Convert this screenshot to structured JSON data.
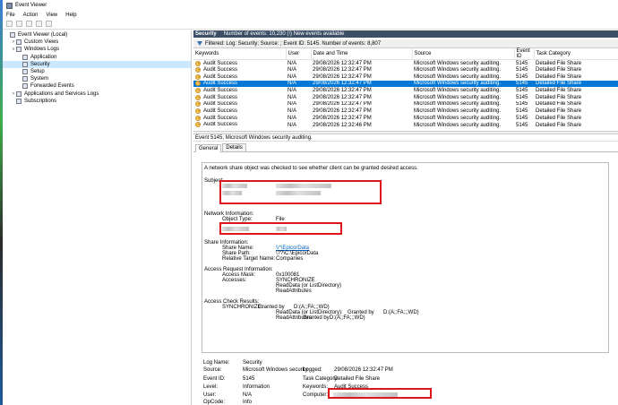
{
  "window": {
    "title": "Event Viewer"
  },
  "menu": [
    "File",
    "Action",
    "View",
    "Help"
  ],
  "tree": [
    {
      "label": "Event Viewer (Local)",
      "indent": 0,
      "toggle": "",
      "selected": false
    },
    {
      "label": "Custom Views",
      "indent": 1,
      "toggle": ">",
      "selected": false
    },
    {
      "label": "Windows Logs",
      "indent": 1,
      "toggle": "v",
      "selected": false
    },
    {
      "label": "Application",
      "indent": 2,
      "toggle": "",
      "selected": false
    },
    {
      "label": "Security",
      "indent": 2,
      "toggle": "",
      "selected": true
    },
    {
      "label": "Setup",
      "indent": 2,
      "toggle": "",
      "selected": false
    },
    {
      "label": "System",
      "indent": 2,
      "toggle": "",
      "selected": false
    },
    {
      "label": "Forwarded Events",
      "indent": 2,
      "toggle": "",
      "selected": false
    },
    {
      "label": "Applications and Services Logs",
      "indent": 1,
      "toggle": ">",
      "selected": false
    },
    {
      "label": "Subscriptions",
      "indent": 1,
      "toggle": "",
      "selected": false
    }
  ],
  "log_header": {
    "name": "Security",
    "info": "Number of events: 10,230 (!) New events available"
  },
  "filter_text": "Filtered: Log: Security; Source: ; Event ID: 5145. Number of events: 8,807",
  "columns": [
    "Keywords",
    "User",
    "Date and Time",
    "Source",
    "Event ID",
    "Task Category"
  ],
  "rows": [
    {
      "keywords": "Audit Success",
      "user": "N/A",
      "date": "29/08/2026 12:32:47 PM",
      "source": "Microsoft Windows security auditing.",
      "id": "5145",
      "category": "Detailed File Share",
      "selected": false
    },
    {
      "keywords": "Audit Success",
      "user": "N/A",
      "date": "29/08/2026 12:32:47 PM",
      "source": "Microsoft Windows security auditing.",
      "id": "5145",
      "category": "Detailed File Share",
      "selected": false
    },
    {
      "keywords": "Audit Success",
      "user": "N/A",
      "date": "29/08/2026 12:32:47 PM",
      "source": "Microsoft Windows security auditing.",
      "id": "5145",
      "category": "Detailed File Share",
      "selected": false
    },
    {
      "keywords": "Audit Success",
      "user": "N/A",
      "date": "29/08/2026 12:32:47 PM",
      "source": "Microsoft Windows security auditing.",
      "id": "5145",
      "category": "Detailed File Share",
      "selected": true
    },
    {
      "keywords": "Audit Success",
      "user": "N/A",
      "date": "29/08/2026 12:32:47 PM",
      "source": "Microsoft Windows security auditing.",
      "id": "5145",
      "category": "Detailed File Share",
      "selected": false
    },
    {
      "keywords": "Audit Success",
      "user": "N/A",
      "date": "29/08/2026 12:32:47 PM",
      "source": "Microsoft Windows security auditing.",
      "id": "5145",
      "category": "Detailed File Share",
      "selected": false
    },
    {
      "keywords": "Audit Success",
      "user": "N/A",
      "date": "29/08/2026 12:32:47 PM",
      "source": "Microsoft Windows security auditing.",
      "id": "5145",
      "category": "Detailed File Share",
      "selected": false
    },
    {
      "keywords": "Audit Success",
      "user": "N/A",
      "date": "29/08/2026 12:32:47 PM",
      "source": "Microsoft Windows security auditing.",
      "id": "5145",
      "category": "Detailed File Share",
      "selected": false
    },
    {
      "keywords": "Audit Success",
      "user": "N/A",
      "date": "29/08/2026 12:32:47 PM",
      "source": "Microsoft Windows security auditing.",
      "id": "5145",
      "category": "Detailed File Share",
      "selected": false
    },
    {
      "keywords": "Audit Success",
      "user": "N/A",
      "date": "29/08/2026 12:32:46 PM",
      "source": "Microsoft Windows security auditing.",
      "id": "5145",
      "category": "Detailed File Share",
      "selected": false
    }
  ],
  "detail": {
    "title": "Event 5145, Microsoft Windows security auditing.",
    "tabs": [
      "General",
      "Details"
    ],
    "intro": "A network share object was checked to see whether client can be granted desired access.",
    "subject_label": "Subject:",
    "network_label": "Network Information:",
    "object_type_label": "Object Type:",
    "object_type_value": "File",
    "share_label": "Share Information:",
    "share_name_label": "Share Name:",
    "share_name_value": "\\\\*\\EpicorData",
    "share_path_label": "Share Path:",
    "share_path_value": "\\??\\C:\\EpicorData",
    "rel_target_label": "Relative Target Name:",
    "rel_target_value": "Companies",
    "access_label": "Access Request Information:",
    "mask_label": "Access Mask:",
    "mask_value": "0x100081",
    "accesses_label": "Accesses:",
    "accesses": [
      "SYNCHRONIZE",
      "ReadData (or ListDirectory)",
      "ReadAttributes"
    ],
    "check_label": "Access Check Results:",
    "check_lines": [
      {
        "a": "SYNCHRONIZE:",
        "b": "Granted by",
        "c": "D:(A;;FA;;;WD)"
      },
      {
        "a": "ReadData (or ListDirectory):",
        "b": "Granted by",
        "c": "D:(A;;FA;;;WD)"
      },
      {
        "a": "ReadAttributes:",
        "b": "Granted by",
        "c": "D:(A;;FA;;;WD)"
      }
    ]
  },
  "props": {
    "log_name_label": "Log Name:",
    "log_name_value": "Security",
    "source_label": "Source:",
    "source_value": "Microsoft Windows security",
    "logged_label": "Logged:",
    "logged_value": "29/08/2026 12:32:47 PM",
    "event_id_label": "Event ID:",
    "event_id_value": "5145",
    "task_label": "Task Category:",
    "task_value": "Detailed File Share",
    "level_label": "Level:",
    "level_value": "Information",
    "keywords_label": "Keywords:",
    "keywords_value": "Audit Success",
    "user_label": "User:",
    "user_value": "N/A",
    "computer_label": "Computer:",
    "opcode_label": "OpCode:",
    "opcode_value": "Info"
  },
  "colors": {
    "header_bg": "#3c4f66",
    "selection": "#0078d7",
    "redaction_box": "#e0141b"
  }
}
